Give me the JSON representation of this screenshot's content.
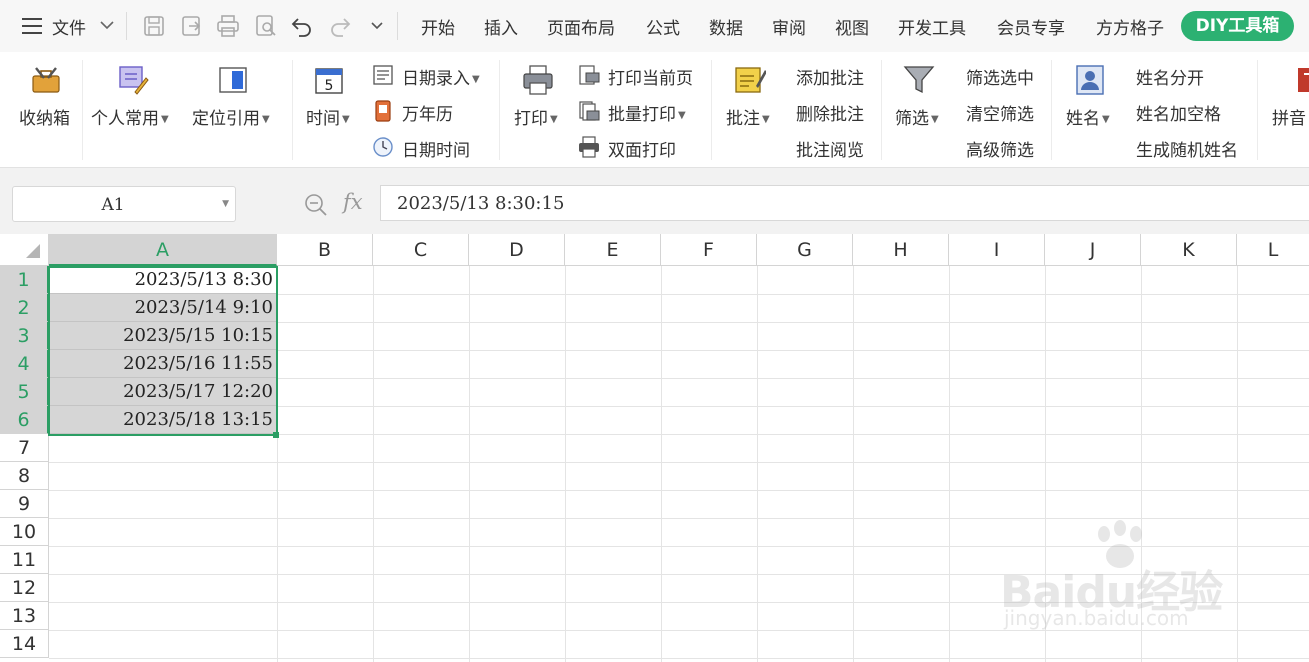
{
  "menubar": {
    "file_label": "文件",
    "tabs": [
      "开始",
      "插入",
      "页面布局",
      "公式",
      "数据",
      "审阅",
      "视图",
      "开发工具",
      "会员专享",
      "方方格子"
    ],
    "active_tab": "DIY工具箱"
  },
  "ribbon": {
    "storage": "收纳箱",
    "personal": "个人常用",
    "locate_ref": "定位引用",
    "time": "时间",
    "date_entry": "日期录入",
    "calendar": "万年历",
    "date_time": "日期时间",
    "print": "打印",
    "print_current": "打印当前页",
    "batch_print": "批量打印",
    "duplex_print": "双面打印",
    "comment": "批注",
    "add_comment": "添加批注",
    "delete_comment": "删除批注",
    "read_comment": "批注阅览",
    "filter": "筛选",
    "filter_selected": "筛选选中",
    "clear_filter": "清空筛选",
    "advanced_filter": "高级筛选",
    "name": "姓名",
    "split_name": "姓名分开",
    "name_space": "姓名加空格",
    "random_name": "生成随机姓名",
    "pinyin": "拼音"
  },
  "formula_bar": {
    "name_box": "A1",
    "fx_label": "fx",
    "formula": "2023/5/13  8:30:15"
  },
  "grid": {
    "columns": [
      "A",
      "B",
      "C",
      "D",
      "E",
      "F",
      "G",
      "H",
      "I",
      "J",
      "K",
      "L"
    ],
    "rows": [
      "1",
      "2",
      "3",
      "4",
      "5",
      "6",
      "7",
      "8",
      "9",
      "10",
      "11",
      "12",
      "13",
      "14"
    ],
    "selected_column": "A",
    "cells_A": [
      "2023/5/13  8:30",
      "2023/5/14  9:10",
      "2023/5/15  10:15",
      "2023/5/16  11:55",
      "2023/5/17  12:20",
      "2023/5/18  13:15"
    ]
  },
  "watermark": {
    "brand": "Bai",
    "brand2": "du",
    "brand3": "经验",
    "url": "jingyan.baidu.com"
  },
  "colors": {
    "accent": "#2cb172",
    "selection": "#2b9e64"
  }
}
